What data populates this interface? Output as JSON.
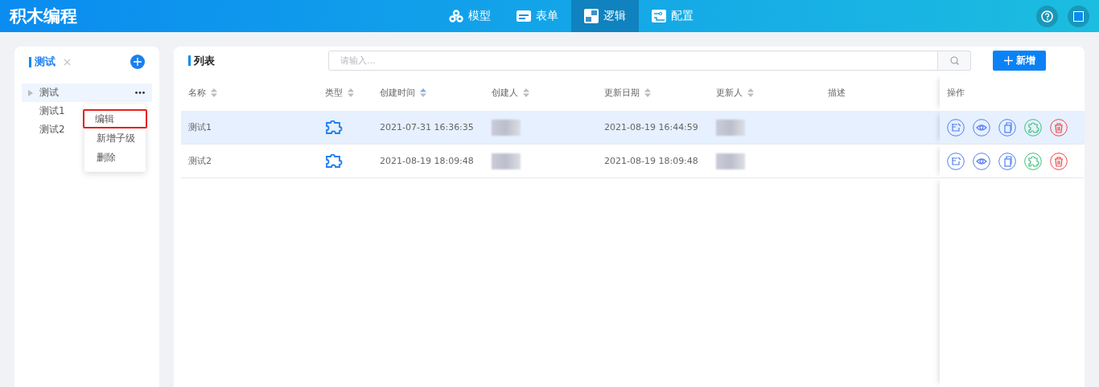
{
  "header": {
    "title": "积木编程",
    "nav": [
      {
        "label": "模型",
        "selected": false
      },
      {
        "label": "表单",
        "selected": false
      },
      {
        "label": "逻辑",
        "selected": true
      },
      {
        "label": "配置",
        "selected": false
      }
    ]
  },
  "sidebar": {
    "title": "测试",
    "tree": [
      {
        "label": "测试",
        "selected": true,
        "children": [
          {
            "label": "测试1",
            "selected": false
          },
          {
            "label": "测试2",
            "selected": false
          }
        ]
      }
    ],
    "context_menu": [
      {
        "label": "编辑",
        "highlighted": true
      },
      {
        "label": "新增子级",
        "highlighted": false
      },
      {
        "label": "删除",
        "highlighted": false
      }
    ]
  },
  "list": {
    "title": "列表",
    "search": {
      "placeholder": "请输入..."
    },
    "add_button": "新增",
    "columns": [
      {
        "label": "名称",
        "sorted": false
      },
      {
        "label": "类型",
        "sorted": false
      },
      {
        "label": "创建时间",
        "sorted": true
      },
      {
        "label": "创建人",
        "sorted": false
      },
      {
        "label": "更新日期",
        "sorted": false
      },
      {
        "label": "更新人",
        "sorted": false
      },
      {
        "label": "描述"
      },
      {
        "label": "操作"
      }
    ],
    "rows": [
      {
        "name": "测试1",
        "created": "2021-07-31 16:36:35",
        "updated": "2021-08-19 16:44:59",
        "selected": true
      },
      {
        "name": "测试2",
        "created": "2021-08-19 18:09:48",
        "updated": "2021-08-19 18:09:48",
        "selected": false
      }
    ]
  }
}
